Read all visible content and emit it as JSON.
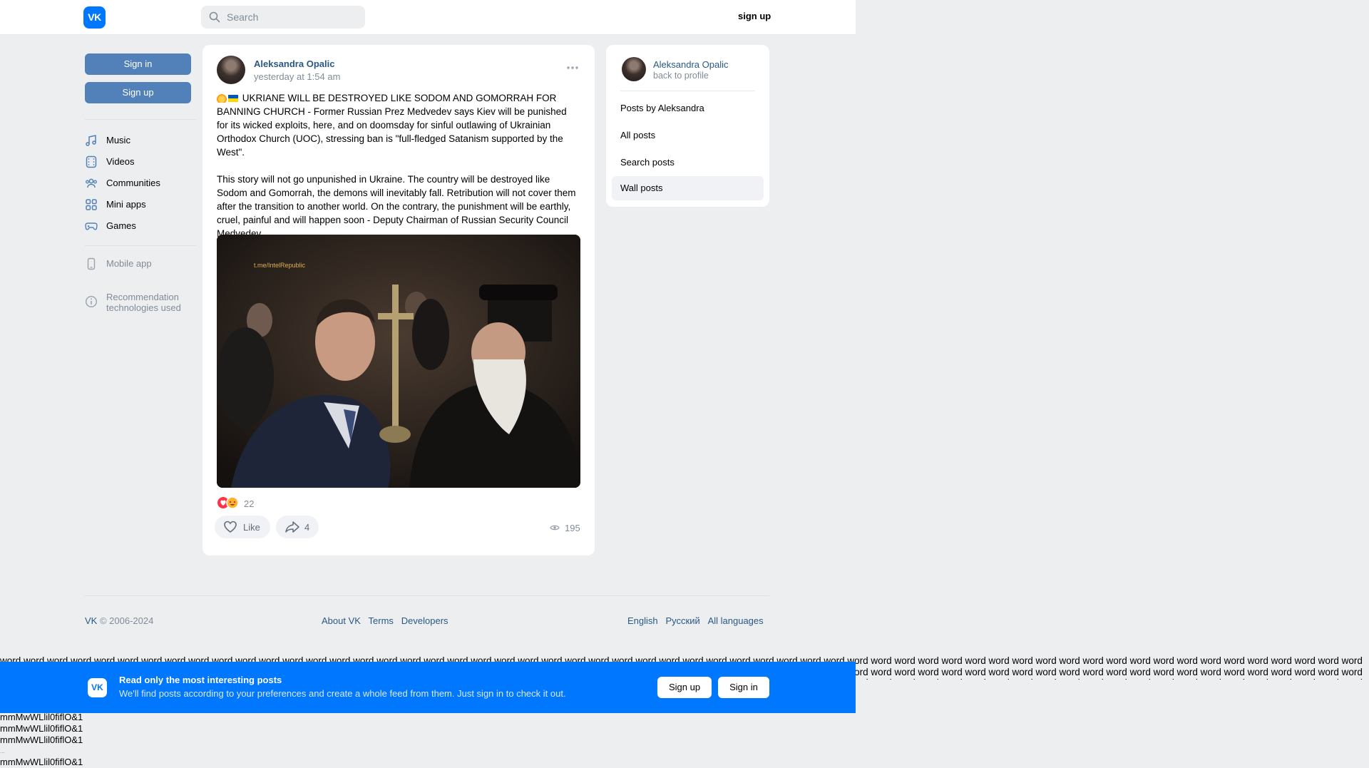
{
  "header": {
    "logo": "VK",
    "search_placeholder": "Search",
    "signup_label": "sign up"
  },
  "sidebar": {
    "signin_label": "Sign in",
    "signup_label": "Sign up",
    "items": [
      {
        "label": "Music",
        "icon": "music-icon"
      },
      {
        "label": "Videos",
        "icon": "video-icon"
      },
      {
        "label": "Communities",
        "icon": "communities-icon"
      },
      {
        "label": "Mini apps",
        "icon": "mini-apps-icon"
      },
      {
        "label": "Games",
        "icon": "gamepad-icon"
      }
    ],
    "mobile_app_label": "Mobile app",
    "recommendation_label": "Recommendation technologies used"
  },
  "post": {
    "author": "Aleksandra Opalic",
    "time": "yesterday at 1:54 am",
    "paragraph1": "UKRIANE WILL BE DESTROYED LIKE SODOM AND GOMORRAH FOR BANNING CHURCH - Former Russian Prez Medvedev says Kiev will be punished for its wicked exploits, here, and on doomsday for sinful outlawing of Ukrainian Orthodox Church (UOC), stressing ban is \"full-fledged Satanism supported by the West\".",
    "paragraph2": "This story will not go unpunished in Ukraine. The country will be destroyed like Sodom and Gomorrah, the demons will inevitably fall. Retribution will not cover them after the transition to another world. On the contrary, the punishment will be earthly, cruel, painful and will happen soon - Deputy Chairman of Russian Security Council Medvedev.",
    "photo_watermark": "t.me/IntelRepublic",
    "reactions_count": "22",
    "like_label": "Like",
    "share_count": "4",
    "views_count": "195"
  },
  "right_card": {
    "name": "Aleksandra Opalic",
    "back_label": "back to profile",
    "links": [
      "Posts by Aleksandra",
      "All posts",
      "Search posts",
      "Wall posts"
    ]
  },
  "footer": {
    "copyright_brand": "VK",
    "copyright_years": "© 2006-2024",
    "links": [
      "About VK",
      "Terms",
      "Developers"
    ],
    "languages": [
      "English",
      "Русский",
      "All languages"
    ]
  },
  "banner": {
    "logo": "VK",
    "title": "Read only the most interesting posts",
    "subtitle": "We'll find posts according to your preferences and create a whole feed from them. Just sign in to check it out.",
    "signup_label": "Sign up",
    "signin_label": "Sign in"
  },
  "debug": {
    "word_row": "word word word word word word word word word word word word word word word word word word word word word word word word word word word word word word word word word word word word word word word word word word word word word word word word word word word word word word word word word word word word word word word word word word word word word word word word word word word word word word word word word word word word word word word word word word word word word word word word word word word word word word word word word word word word word word word word word word word word word word word word word word word word word word word word word word word word word word word word word word word word word word word word word word word word word word word word word word word word word word word word word word word word word word word word word word word word word word word word word word word word word word word word word word word word word word word word word word word word word word",
    "glyph_line": "mmMwWLlil0fiflO&1",
    "ellipsis": "..."
  }
}
